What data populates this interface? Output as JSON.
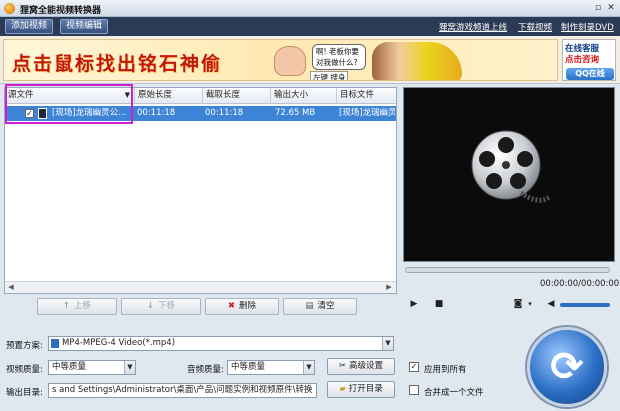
{
  "window": {
    "title": "狸窝全能视频转换器",
    "min": "▫",
    "close": "✕"
  },
  "toolbar": {
    "add_video": "添加视频",
    "edit_video": "视频编辑",
    "links": [
      "狸窝游戏频道上线",
      "下载视频",
      "制作刻录DVD"
    ]
  },
  "banner": {
    "slogan": "点击鼠标找出铭石神偷",
    "bubble": "啊! 老板你要对我做什么?",
    "bubble_tag": "左键 搜身",
    "online_line1": "在线客服",
    "online_line2": "点击咨询",
    "qq": "QQ在线"
  },
  "file_list": {
    "columns": [
      "源文件",
      "原始长度",
      "截取长度",
      "输出大小",
      "目标文件"
    ],
    "rows": [
      {
        "checked": "✓",
        "source": "[现场]龙瑞幽灵公...",
        "original_length": "00:11:18",
        "clip_length": "00:11:18",
        "output_size": "72.65 MB",
        "target": "[现场]龙瑞幽灵..."
      }
    ]
  },
  "actions": {
    "move_up": "上移",
    "move_down": "下移",
    "delete": "删除",
    "clear": "清空"
  },
  "player": {
    "time": "00:00:00/00:00:00"
  },
  "settings": {
    "preset_label": "预置方案:",
    "preset_value": "MP4-MPEG-4 Video(*.mp4)",
    "video_quality_label": "视频质量:",
    "video_quality_value": "中等质量",
    "audio_quality_label": "音频质量:",
    "audio_quality_value": "中等质量",
    "advanced": "高级设置",
    "apply_all": "应用到所有",
    "output_label": "输出目录:",
    "output_path": "s and Settings\\Administrator\\桌面\\产品\\问题实例和视频原件\\转换",
    "open_dir": "打开目录",
    "merge": "合并成一个文件"
  },
  "colors": {
    "accent": "#3d84d6",
    "highlight": "#d21ed2",
    "slogan": "#c4160e"
  }
}
